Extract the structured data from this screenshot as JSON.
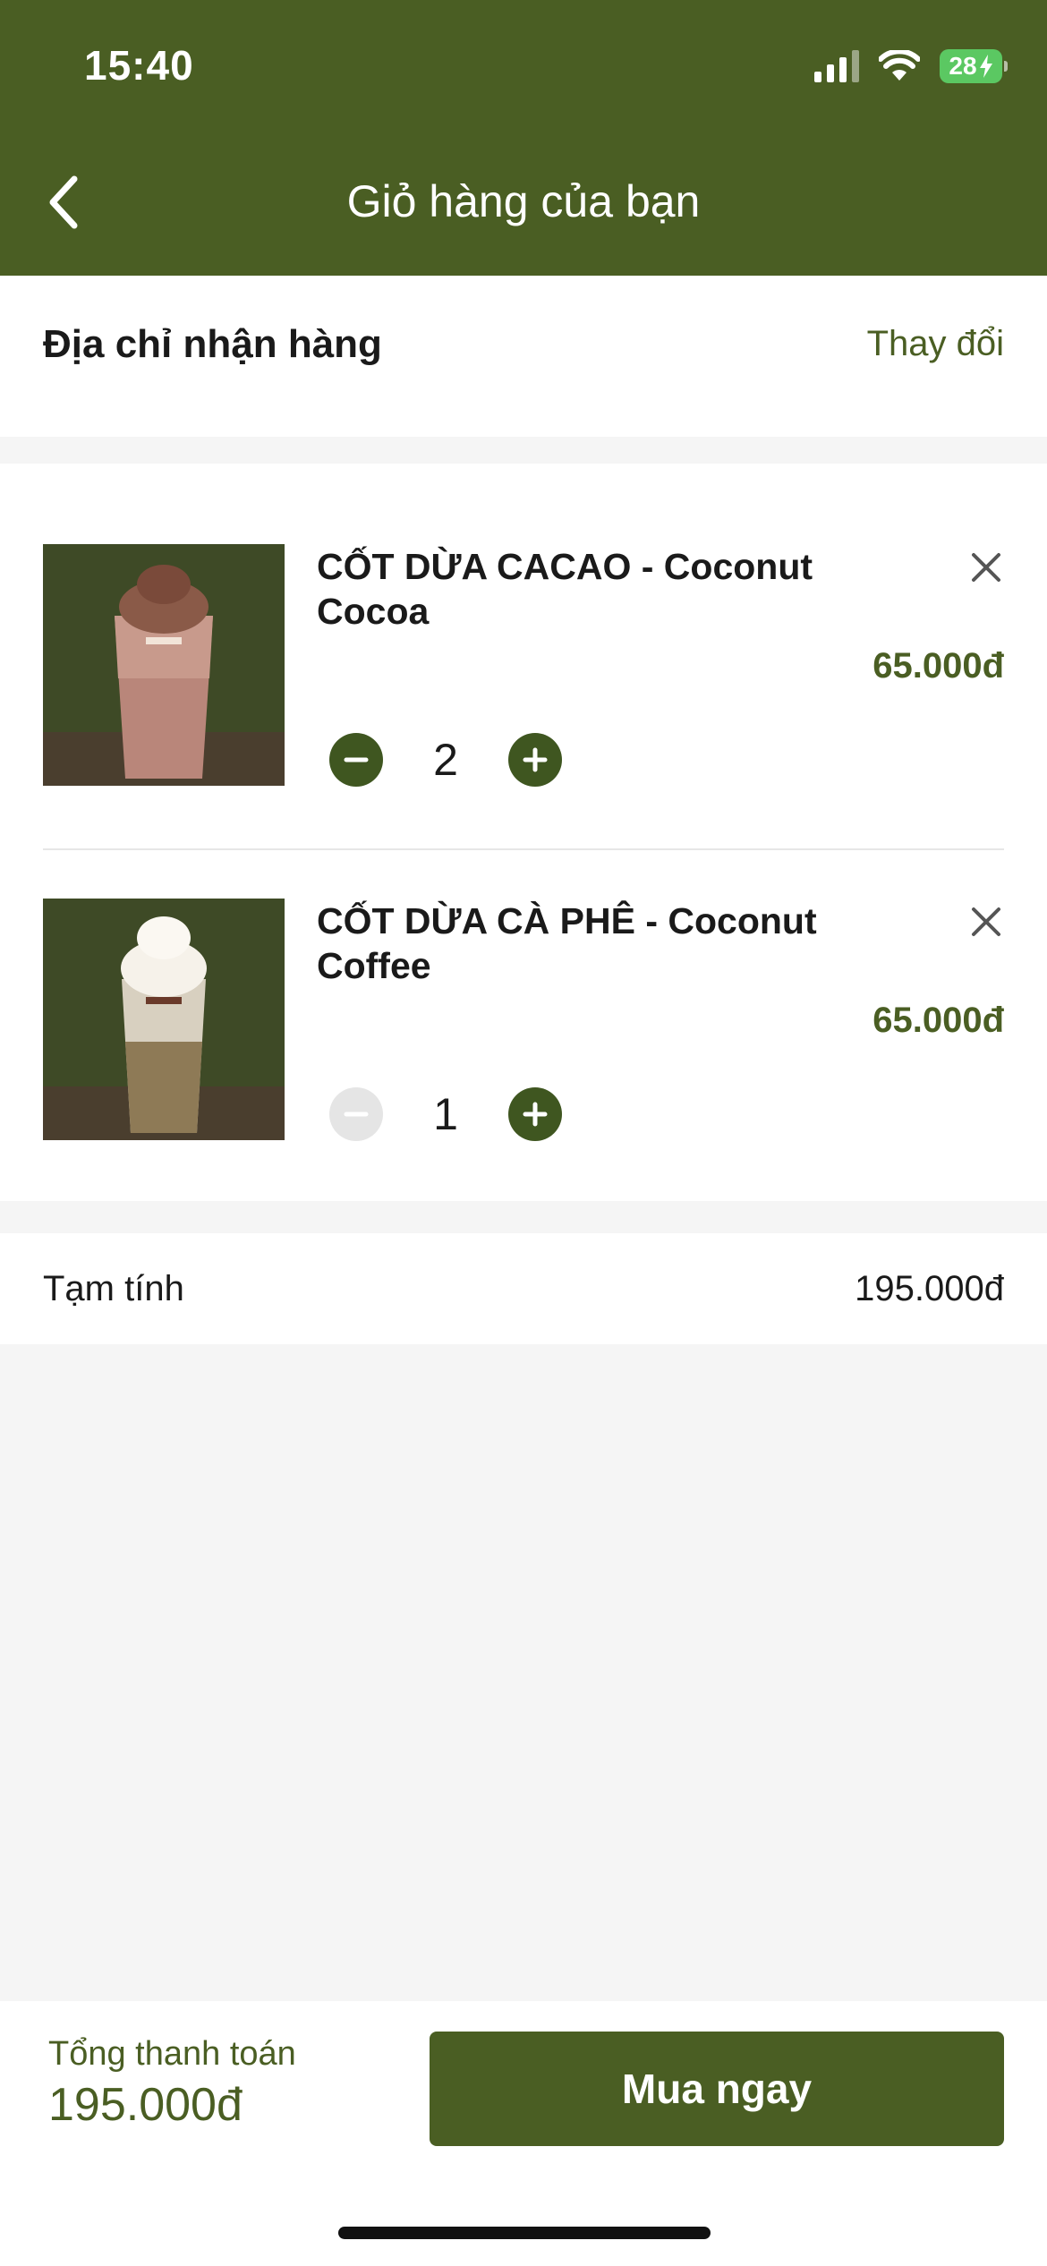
{
  "status_bar": {
    "time": "15:40",
    "battery": "28"
  },
  "header": {
    "title": "Giỏ hàng của bạn",
    "back_icon": "chevron-left-icon"
  },
  "address": {
    "label": "Địa chỉ nhận hàng",
    "change_label": "Thay đổi"
  },
  "cart": {
    "items": [
      {
        "name": "CỐT DỪA CACAO - Coconut Cocoa",
        "price": "65.000đ",
        "quantity": "2",
        "minus_enabled": true
      },
      {
        "name": "CỐT DỪA CÀ PHÊ  - Coconut Coffee",
        "price": "65.000đ",
        "quantity": "1",
        "minus_enabled": false
      }
    ]
  },
  "subtotal": {
    "label": "Tạm tính",
    "value": "195.000đ"
  },
  "footer": {
    "total_label": "Tổng thanh toán",
    "total_value": "195.000đ",
    "buy_label": "Mua ngay"
  },
  "colors": {
    "brand": "#4a5e23",
    "background": "#f5f5f5",
    "disabled": "#e5e5e5"
  }
}
